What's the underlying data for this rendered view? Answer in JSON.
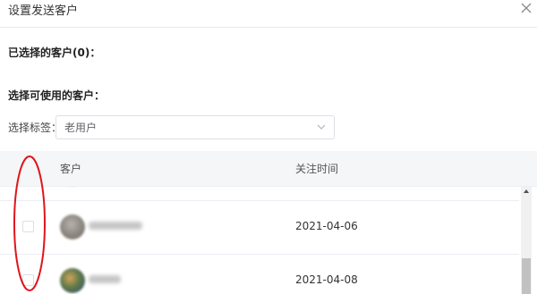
{
  "dialog": {
    "title": "设置发送客户",
    "close_icon": "close-icon"
  },
  "selected_section": {
    "label": "已选择的客户(0)："
  },
  "available_section": {
    "label": "选择可使用的客户："
  },
  "tag_filter": {
    "label": "选择标签：",
    "value": "老用户",
    "icon": "chevron-down-icon"
  },
  "table": {
    "columns": [
      "客户",
      "关注时间"
    ],
    "rows": [
      {
        "date": "2021-04-06"
      },
      {
        "date": "2021-04-08"
      }
    ]
  },
  "colors": {
    "annotation": "#e0151b",
    "border": "#dcdfe6",
    "header_bg": "#f5f6f7"
  }
}
